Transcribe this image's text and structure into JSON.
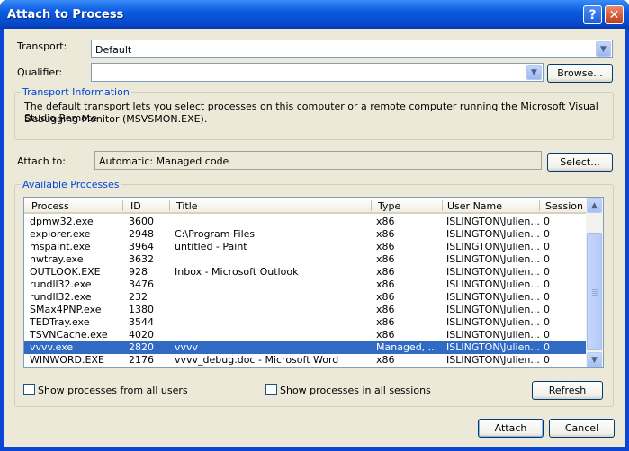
{
  "window": {
    "title": "Attach to Process"
  },
  "transport": {
    "label": "Transport:",
    "value": "Default"
  },
  "qualifier": {
    "label": "Qualifier:",
    "value": "",
    "browse_label": "Browse..."
  },
  "transport_info": {
    "title": "Transport Information",
    "line1": "The default transport lets you select processes on this computer or a remote computer running the Microsoft Visual Studio Remote",
    "line2": "Debugging Monitor (MSVSMON.EXE)."
  },
  "attach_to": {
    "label": "Attach to:",
    "value": "Automatic: Managed code",
    "select_label": "Select..."
  },
  "processes": {
    "title": "Available Processes",
    "columns": [
      "Process",
      "ID",
      "Title",
      "Type",
      "User Name",
      "Session"
    ],
    "rows": [
      [
        "dpmw32.exe",
        "3600",
        "",
        "x86",
        "ISLINGTON\\Julien...",
        "0"
      ],
      [
        "explorer.exe",
        "2948",
        "C:\\Program Files",
        "x86",
        "ISLINGTON\\Julien...",
        "0"
      ],
      [
        "mspaint.exe",
        "3964",
        "untitled - Paint",
        "x86",
        "ISLINGTON\\Julien...",
        "0"
      ],
      [
        "nwtray.exe",
        "3632",
        "",
        "x86",
        "ISLINGTON\\Julien...",
        "0"
      ],
      [
        "OUTLOOK.EXE",
        "928",
        "Inbox - Microsoft Outlook",
        "x86",
        "ISLINGTON\\Julien...",
        "0"
      ],
      [
        "rundll32.exe",
        "3476",
        "",
        "x86",
        "ISLINGTON\\Julien...",
        "0"
      ],
      [
        "rundll32.exe",
        "232",
        "",
        "x86",
        "ISLINGTON\\Julien...",
        "0"
      ],
      [
        "SMax4PNP.exe",
        "1380",
        "",
        "x86",
        "ISLINGTON\\Julien...",
        "0"
      ],
      [
        "TEDTray.exe",
        "3544",
        "",
        "x86",
        "ISLINGTON\\Julien...",
        "0"
      ],
      [
        "TSVNCache.exe",
        "4020",
        "",
        "x86",
        "ISLINGTON\\Julien...",
        "0"
      ],
      [
        "vvvv.exe",
        "2820",
        "vvvv",
        "Managed, ...",
        "ISLINGTON\\Julien...",
        "0"
      ],
      [
        "WINWORD.EXE",
        "2176",
        "vvvv_debug.doc - Microsoft Word",
        "x86",
        "ISLINGTON\\Julien...",
        "0"
      ]
    ],
    "selected_index": 10,
    "show_all_users": "Show processes from all users",
    "show_all_sessions": "Show processes in all sessions",
    "refresh_label": "Refresh"
  },
  "footer": {
    "attach_label": "Attach",
    "cancel_label": "Cancel"
  }
}
